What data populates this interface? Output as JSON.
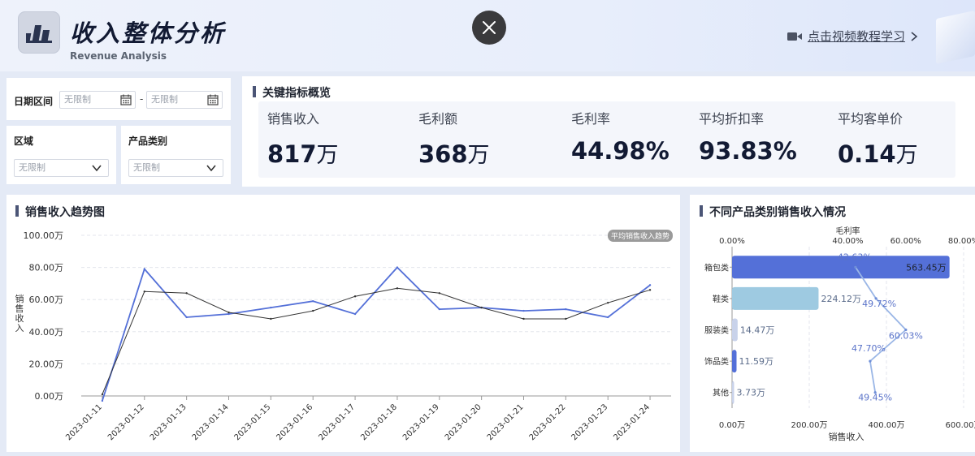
{
  "header": {
    "title": "收入整体分析",
    "subtitle": "Revenue Analysis",
    "tutorial_label": "点击视频教程学习",
    "tutorial_icon": "video-icon",
    "close_icon": "close-icon"
  },
  "filters": {
    "date_label": "日期区间",
    "date_start_placeholder": "无限制",
    "date_sep": "-",
    "date_end_placeholder": "无限制",
    "region_label": "区域",
    "region_value": "无限制",
    "category_label": "产品类别",
    "category_value": "无限制"
  },
  "kpi": {
    "title": "关键指标概览",
    "items": [
      {
        "label": "销售收入",
        "value": "817",
        "unit": "万"
      },
      {
        "label": "毛利额",
        "value": "368",
        "unit": "万"
      },
      {
        "label": "毛利率",
        "value": "44.98%",
        "unit": ""
      },
      {
        "label": "平均折扣率",
        "value": "93.83%",
        "unit": ""
      },
      {
        "label": "平均客单价",
        "value": "0.14",
        "unit": "万"
      }
    ]
  },
  "trend": {
    "title": "销售收入趋势图"
  },
  "category": {
    "title": "不同产品类别销售收入情况"
  },
  "colors": {
    "accent": "#5470d8",
    "light_blue": "#9ecae1",
    "dark_line": "#333333",
    "title_bar": "#4b5576"
  },
  "chart_data": [
    {
      "type": "line",
      "title": "销售收入趋势图",
      "ylabel": "销售收入",
      "ylim": [
        0,
        100
      ],
      "y_ticks": [
        "0.00万",
        "20.00万",
        "40.00万",
        "60.00万",
        "80.00万",
        "100.00万"
      ],
      "x": [
        "2023-01-11",
        "2023-01-12",
        "2023-01-13",
        "2023-01-14",
        "2023-01-15",
        "2023-01-16",
        "2023-01-17",
        "2023-01-18",
        "2023-01-19",
        "2023-01-20",
        "2023-01-21",
        "2023-01-22",
        "2023-01-23",
        "2023-01-24"
      ],
      "series": [
        {
          "name": "",
          "color": "#5470d8",
          "values": [
            -3,
            79,
            49,
            51,
            55,
            59,
            51,
            80,
            54,
            55,
            53,
            54,
            49,
            69
          ]
        },
        {
          "name": "平均销售收入趋势",
          "color": "#333333",
          "values": [
            1,
            65,
            64,
            52,
            48,
            53,
            62,
            67,
            64,
            55,
            48,
            48,
            58,
            66
          ]
        }
      ],
      "legend": "top-right",
      "grid": true
    },
    {
      "type": "bar",
      "orientation": "horizontal",
      "title": "不同产品类别销售收入情况",
      "categories": [
        "箱包类",
        "鞋类",
        "服装类",
        "饰品类",
        "其他"
      ],
      "values": [
        563.45,
        224.12,
        14.47,
        11.59,
        3.73
      ],
      "value_labels": [
        "563.45万",
        "224.12万",
        "14.47万",
        "11.59万",
        "3.73万"
      ],
      "bar_colors": [
        "#5470d8",
        "#9ecae1",
        "#c8d2ea",
        "#5470d8",
        "#c8d2ea"
      ],
      "xlabel": "销售收入",
      "xlim": [
        0,
        600
      ],
      "x_ticks": [
        "0.00万",
        "200.00万",
        "400.00万",
        "600.00万"
      ],
      "secondary": {
        "name": "毛利率",
        "type": "line",
        "values": [
          42.63,
          49.72,
          60.03,
          47.7,
          49.45
        ],
        "value_labels": [
          "42.63%",
          "49.72%",
          "60.03%",
          "47.70%",
          "49.45%"
        ],
        "xlim": [
          0,
          80
        ],
        "x_ticks": [
          "0.00%",
          "40.00%",
          "60.00%",
          "80.00%"
        ]
      },
      "grid": true
    }
  ]
}
